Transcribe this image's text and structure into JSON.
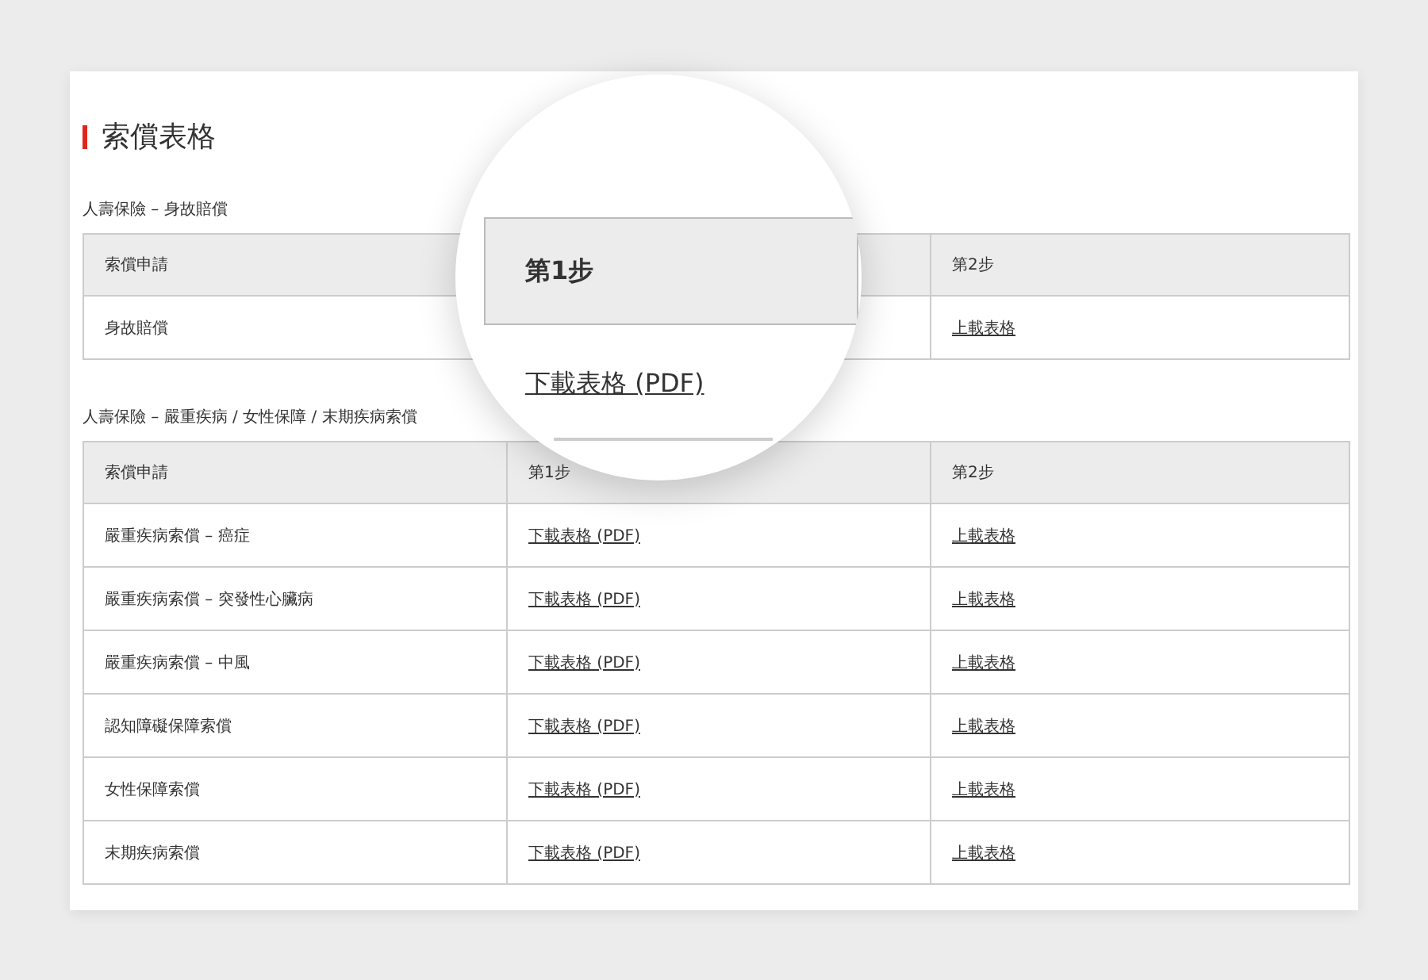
{
  "title": "索償表格",
  "sections": [
    {
      "label": "人壽保險 – 身故賠償",
      "header": {
        "claim": "索償申請",
        "step2": "第2步"
      },
      "rows": [
        {
          "claim": "身故賠償",
          "step2": "上載表格"
        }
      ]
    },
    {
      "label": "人壽保險 – 嚴重疾病 / 女性保障 / 末期疾病索償",
      "header": {
        "claim": "索償申請",
        "step1": "第1步",
        "step2": "第2步"
      },
      "rows": [
        {
          "claim": "嚴重疾病索償 – 癌症",
          "step1": "下載表格 (PDF)",
          "step2": "上載表格"
        },
        {
          "claim": "嚴重疾病索償 – 突發性心臟病",
          "step1": "下載表格 (PDF)",
          "step2": "上載表格"
        },
        {
          "claim": "嚴重疾病索償 – 中風",
          "step1": "下載表格 (PDF)",
          "step2": "上載表格"
        },
        {
          "claim": "認知障礙保障索償",
          "step1": "下載表格 (PDF)",
          "step2": "上載表格"
        },
        {
          "claim": "女性保障索償",
          "step1": "下載表格 (PDF)",
          "step2": "上載表格"
        },
        {
          "claim": "末期疾病索償",
          "step1": "下載表格 (PDF)",
          "step2": "上載表格"
        }
      ]
    }
  ],
  "magnifier": {
    "header": "第1步",
    "link": "下載表格 (PDF)"
  }
}
